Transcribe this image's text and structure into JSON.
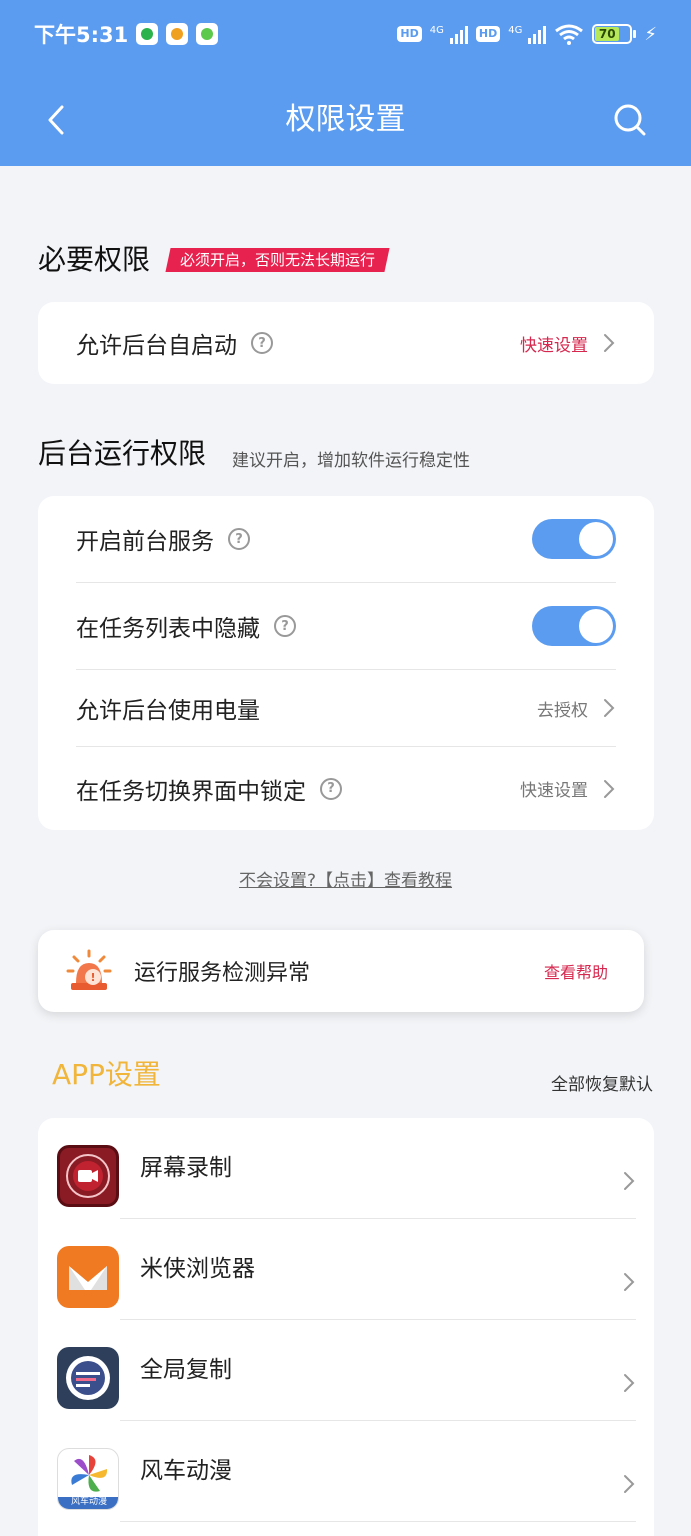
{
  "status_bar": {
    "time": "下午5:31",
    "hd1": "HD",
    "net1": "4G",
    "hd2": "HD",
    "net2": "4G",
    "battery": "70"
  },
  "header": {
    "title": "权限设置",
    "back_icon": "chevron-left-icon",
    "search_icon": "search-icon",
    "bg_color": "#5b9cf0"
  },
  "required": {
    "title": "必要权限",
    "badge": "必须开启，否则无法长期运行",
    "row": {
      "label": "允许后台自启动",
      "action": "快速设置"
    }
  },
  "background": {
    "title": "后台运行权限",
    "hint": "建议开启，增加软件运行稳定性",
    "rows": [
      {
        "label": "开启前台服务",
        "toggle": true
      },
      {
        "label": "在任务列表中隐藏",
        "toggle": true
      },
      {
        "label": "允许后台使用电量",
        "action": "去授权"
      },
      {
        "label": "在任务切换界面中锁定",
        "action": "快速设置"
      }
    ]
  },
  "tutorial_link": "不会设置?【点击】查看教程",
  "alert": {
    "text": "运行服务检测异常",
    "help": "查看帮助",
    "icon": "alarm-light-icon"
  },
  "app_settings": {
    "title": "APP设置",
    "restore": "全部恢复默认",
    "apps": [
      {
        "name": "屏幕录制",
        "icon": "screen-record-icon"
      },
      {
        "name": "米侠浏览器",
        "icon": "mixia-browser-icon"
      },
      {
        "name": "全局复制",
        "icon": "global-copy-icon"
      },
      {
        "name": "风车动漫",
        "icon": "pinwheel-anime-icon",
        "icon_caption": "风车动漫"
      }
    ]
  },
  "colors": {
    "accent": "#5b9cf0",
    "warning_red": "#e8224f",
    "app_title": "#f0b53a"
  }
}
